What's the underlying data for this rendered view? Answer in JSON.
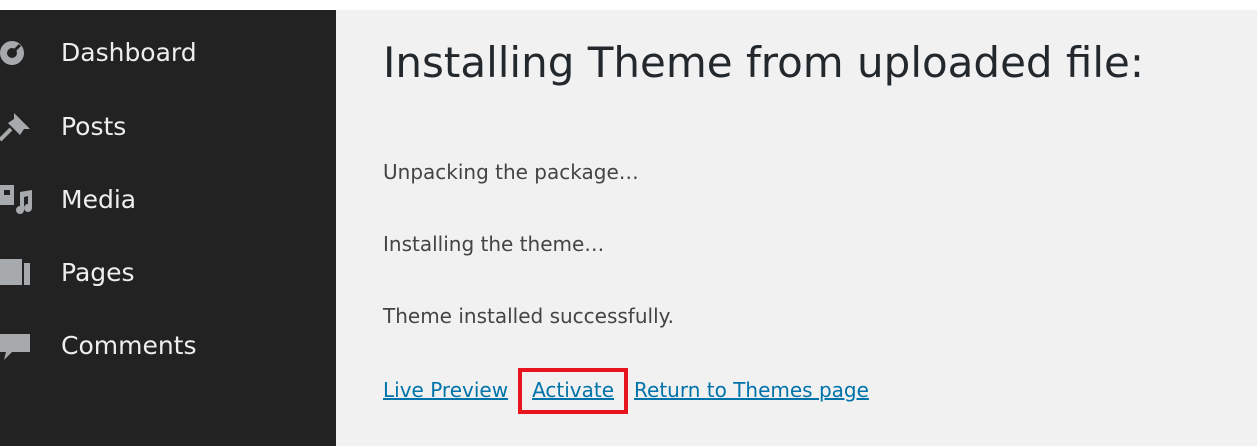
{
  "sidebar": {
    "items": [
      {
        "label": "Dashboard",
        "icon": "dashboard-icon"
      },
      {
        "label": "Posts",
        "icon": "pin-icon"
      },
      {
        "label": "Media",
        "icon": "media-icon"
      },
      {
        "label": "Pages",
        "icon": "pages-icon"
      },
      {
        "label": "Comments",
        "icon": "comment-icon"
      }
    ]
  },
  "main": {
    "title": "Installing Theme from uploaded file:",
    "messages": [
      "Unpacking the package…",
      "Installing the theme…",
      "Theme installed successfully."
    ],
    "links": {
      "live_preview": "Live Preview",
      "activate": "Activate",
      "return_to_themes": "Return to Themes page"
    }
  },
  "colors": {
    "sidebar_bg": "#222222",
    "content_bg": "#f1f1f1",
    "link": "#0073aa",
    "highlight": "#e8141e"
  }
}
